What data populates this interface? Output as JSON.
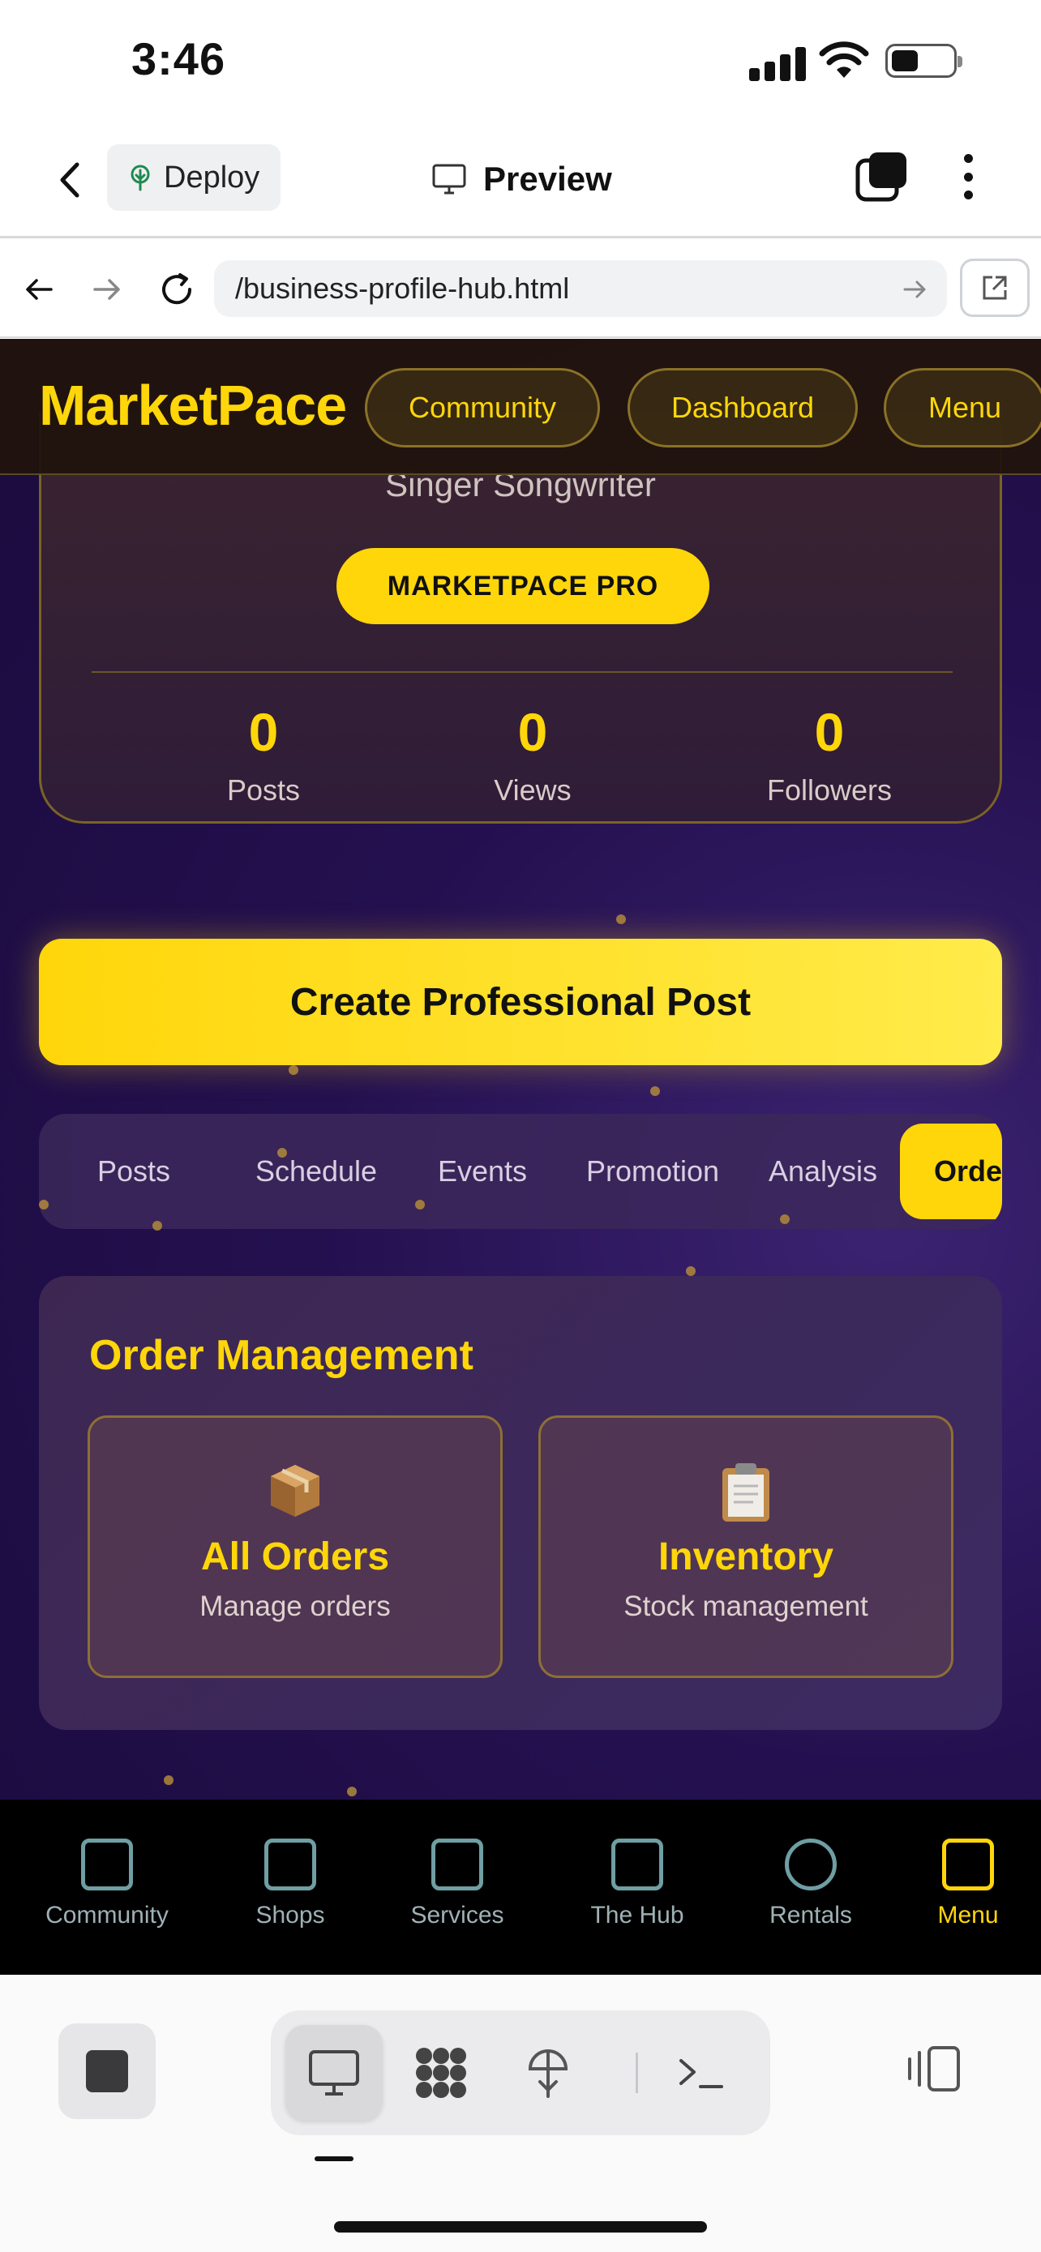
{
  "status_bar": {
    "time": "3:46"
  },
  "app_bar": {
    "deploy_label": "Deploy",
    "title": "Preview"
  },
  "url_bar": {
    "url": "/business-profile-hub.html"
  },
  "site": {
    "logo": "MarketPace",
    "header_buttons": [
      "Community",
      "Dashboard",
      "Menu"
    ],
    "profile": {
      "subtitle": "Singer Songwriter",
      "badge": "MARKETPACE PRO",
      "stats": [
        {
          "value": "0",
          "label": "Posts"
        },
        {
          "value": "0",
          "label": "Views"
        },
        {
          "value": "0",
          "label": "Followers"
        }
      ]
    },
    "cta_label": "Create Professional Post",
    "tabs": [
      "Posts",
      "Schedule",
      "Events",
      "Promotion",
      "Analysis",
      "Orde"
    ],
    "active_tab": "Orders",
    "panel": {
      "title": "Order Management",
      "cards": [
        {
          "icon": "package-icon",
          "title": "All Orders",
          "subtitle": "Manage orders"
        },
        {
          "icon": "clipboard-icon",
          "title": "Inventory",
          "subtitle": "Stock management"
        }
      ]
    },
    "bottom_nav": [
      {
        "label": "Community",
        "icon": "community-icon"
      },
      {
        "label": "Shops",
        "icon": "shopping-bag-icon"
      },
      {
        "label": "Services",
        "icon": "wrench-icon"
      },
      {
        "label": "The Hub",
        "icon": "video-camera-icon"
      },
      {
        "label": "Rentals",
        "icon": "clock-icon"
      },
      {
        "label": "Menu",
        "icon": "menu-icon",
        "active": true
      }
    ]
  },
  "colors": {
    "accent": "#ffd60a",
    "background": "#24104f",
    "header": "#20140e"
  }
}
